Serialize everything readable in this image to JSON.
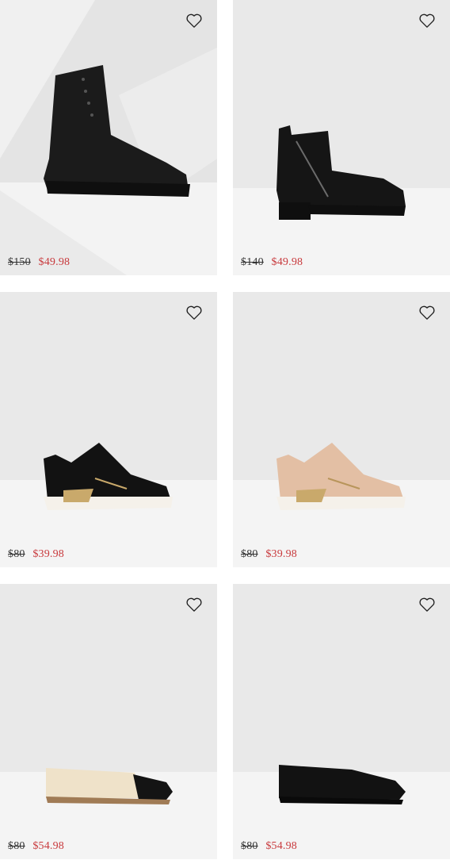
{
  "colors": {
    "sale": "#c8393c",
    "original": "#333333",
    "card_bg": "#e9e9e9"
  },
  "products": [
    {
      "image": "black-lace-up-combat-boot",
      "original_price": "$150",
      "sale_price": "$49.98"
    },
    {
      "image": "black-zip-ankle-bootie",
      "original_price": "$140",
      "sale_price": "$49.98"
    },
    {
      "image": "black-zip-sneaker",
      "original_price": "$80",
      "sale_price": "$39.98"
    },
    {
      "image": "blush-zip-sneaker",
      "original_price": "$80",
      "sale_price": "$39.98"
    },
    {
      "image": "nude-cap-toe-loafer",
      "original_price": "$80",
      "sale_price": "$54.98"
    },
    {
      "image": "black-smoking-loafer",
      "original_price": "$80",
      "sale_price": "$54.98"
    }
  ],
  "icons": {
    "favorite": "heart-outline-icon"
  }
}
